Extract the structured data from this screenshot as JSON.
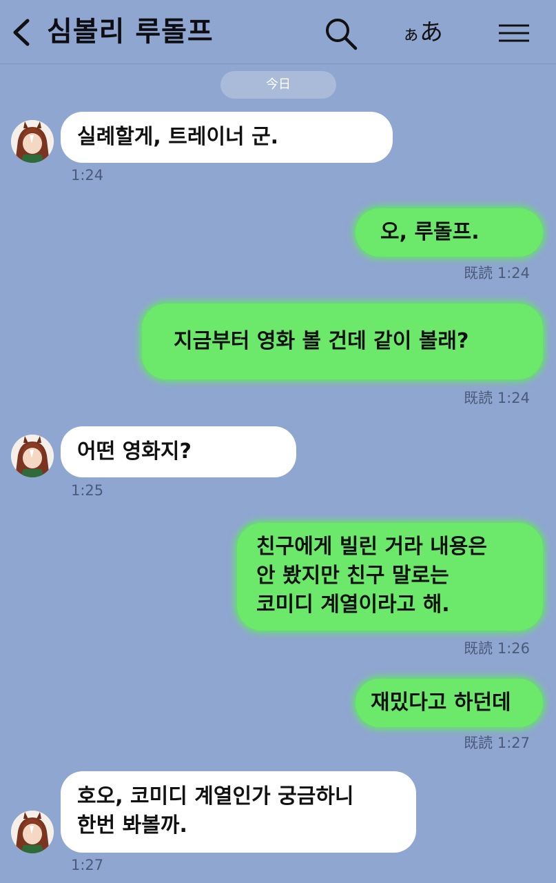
{
  "header": {
    "title": "심볼리 루돌프",
    "font_small": "ぁ",
    "font_big": "あ"
  },
  "date_pill": "今日",
  "read_label": "既読",
  "messages": [
    {
      "side": "in",
      "lines": [
        "실례할게, 트레이너 군."
      ],
      "time": "1:24"
    },
    {
      "side": "out",
      "lines": [
        "오, 루돌프."
      ],
      "time": "1:24"
    },
    {
      "side": "out",
      "lines": [
        "지금부터 영화 볼 건데 같이 볼래?"
      ],
      "time": "1:24"
    },
    {
      "side": "in",
      "lines": [
        "어떤 영화지?"
      ],
      "time": "1:25"
    },
    {
      "side": "out",
      "lines": [
        "친구에게 빌린 거라 내용은",
        "안 봤지만 친구 말로는",
        "코미디 계열이라고 해."
      ],
      "time": "1:26"
    },
    {
      "side": "out",
      "lines": [
        "재밌다고 하던데"
      ],
      "time": "1:27"
    },
    {
      "side": "in",
      "lines": [
        "호오, 코미디 계열인가 궁금하니",
        "한번 봐볼까."
      ],
      "time": "1:27"
    }
  ],
  "colors": {
    "background": "#8fa6d0",
    "incoming_bubble": "#ffffff",
    "outgoing_bubble": "#6ce86b"
  }
}
